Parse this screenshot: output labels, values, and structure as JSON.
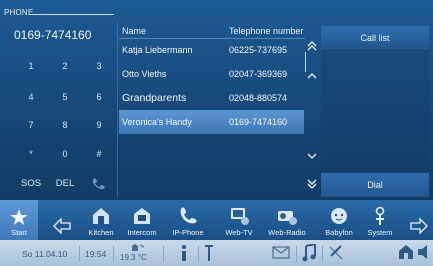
{
  "window": {
    "title": "PHONE"
  },
  "keypad": {
    "display": "0169-7474160",
    "keys": [
      "1",
      "2",
      "3",
      "4",
      "5",
      "6",
      "7",
      "8",
      "9",
      "*",
      "0",
      "#"
    ],
    "sos": "SOS",
    "del": "DEL",
    "hangup_icon": "phone-hangup-icon"
  },
  "contacts": {
    "col_name": "Name",
    "col_tel": "Telephone number",
    "rows": [
      {
        "name": "Katja Liebermann",
        "tel": "06225-737695"
      },
      {
        "name": "Otto Vieths",
        "tel": "02047-369369"
      },
      {
        "name": "Grandparents",
        "tel": "02048-880574"
      },
      {
        "name": "Veronica's Handy",
        "tel": "0169-7474160"
      }
    ],
    "selected_index": 3
  },
  "side": {
    "call_list": "Call list",
    "dial": "Dial"
  },
  "dock": {
    "start": "Start",
    "kitchen": "Kitchen",
    "intercom": "Intercom",
    "ipphone": "IP-Phone",
    "webtv": "Web-TV",
    "webradio": "Web-Radio",
    "babyfon": "Babyfon",
    "system": "System"
  },
  "status": {
    "date": "So 11.04.10",
    "time": "19:54",
    "temp": "19.3 °C"
  },
  "colors": {
    "accent": "#3e78b7",
    "background": "#14426f",
    "status_bar": "#b9cde2"
  }
}
